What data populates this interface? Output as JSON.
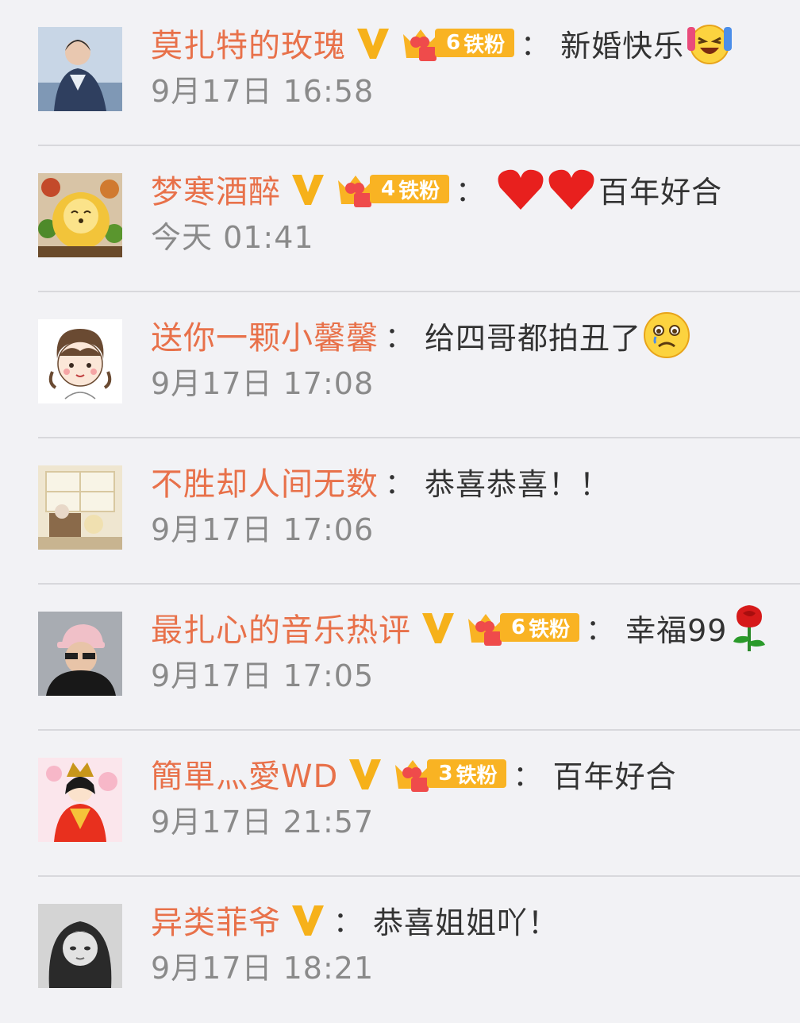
{
  "comments": [
    {
      "name": "莫扎特的玫瑰",
      "verified": true,
      "fan_badge": {
        "level": "6",
        "label": "铁粉"
      },
      "colon": "：",
      "text": "新婚快乐",
      "emoji": "laughing-tears-emoji",
      "time": "9月17日 16:58",
      "avatar": "avatar-woman-photo"
    },
    {
      "name": "梦寒酒醉",
      "verified": true,
      "fan_badge": {
        "level": "4",
        "label": "铁粉"
      },
      "colon": "：",
      "text": "百年好合",
      "emoji_before": "two-red-hearts-emoji",
      "time": "今天 01:41",
      "avatar": "avatar-lion-food"
    },
    {
      "name": "送你一颗小馨馨",
      "verified": false,
      "colon": "：",
      "text": "给四哥都拍丑了",
      "emoji": "sad-tears-emoji",
      "time": "9月17日 17:08",
      "avatar": "avatar-cartoon-girl"
    },
    {
      "name": "不胜却人间无数",
      "verified": false,
      "colon": "：",
      "text": "恭喜恭喜！！",
      "time": "9月17日 17:06",
      "avatar": "avatar-room-illustration"
    },
    {
      "name": "最扎心的音乐热评",
      "verified": true,
      "fan_badge": {
        "level": "6",
        "label": "铁粉"
      },
      "colon": "：",
      "text": "幸福99",
      "emoji": "rose-emoji",
      "time": "9月17日 17:05",
      "avatar": "avatar-man-cap"
    },
    {
      "name": "簡單灬愛WD",
      "verified": true,
      "fan_badge": {
        "level": "3",
        "label": "铁粉"
      },
      "colon": "：",
      "text": "百年好合",
      "time": "9月17日 21:57",
      "avatar": "avatar-princess-doll"
    },
    {
      "name": "异类菲爷",
      "verified": true,
      "colon": "：",
      "text": "恭喜姐姐吖！",
      "time": "9月17日 18:21",
      "avatar": "avatar-woman-bw"
    }
  ],
  "colors": {
    "name": "#e8714a",
    "verified": "#f6b11a",
    "fan_badge": "#f9b323",
    "text": "#333333",
    "time": "#8a8a8a",
    "background": "#f2f2f5"
  }
}
